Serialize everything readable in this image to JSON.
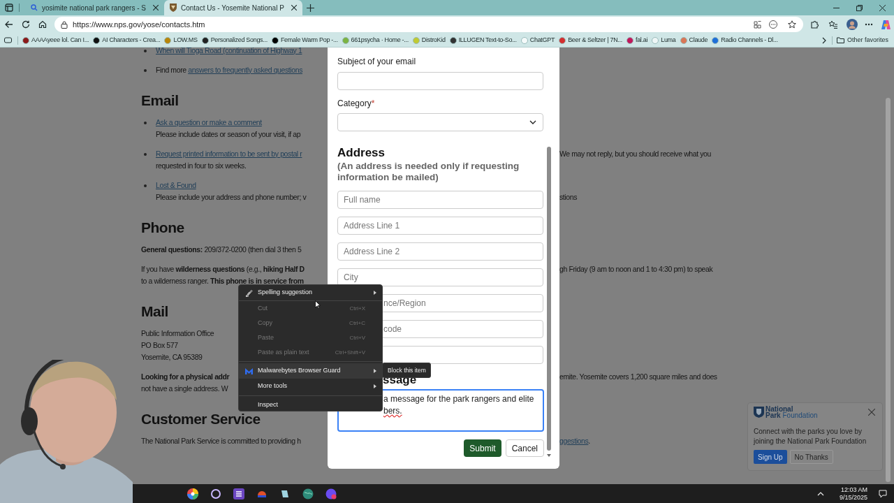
{
  "tabs": [
    {
      "title": "yosimite national park rangers - S",
      "kind": "search",
      "selected": false
    },
    {
      "title": "Contact Us - Yosemite National P",
      "kind": "site",
      "selected": true
    }
  ],
  "address_bar": {
    "url": "https://www.nps.gov/yose/contacts.htm"
  },
  "bookmarks": [
    {
      "label": "AAAAyeee lol. Can I...",
      "color": "#8b1a1a"
    },
    {
      "label": "AI Characters - Crea...",
      "color": "#111111"
    },
    {
      "label": "LOW.MS",
      "color": "#b8860b"
    },
    {
      "label": "Personalized Songs...",
      "color": "#222222"
    },
    {
      "label": "Female Warm Pop -...",
      "color": "#000000"
    },
    {
      "label": "661psycha · Home -...",
      "color": "#7cb342"
    },
    {
      "label": "DistroKid",
      "color": "#c0ca33"
    },
    {
      "label": "ILLUGEN Text-to-So...",
      "color": "#333333"
    },
    {
      "label": "ChatGPT",
      "color": "#f4fafa"
    },
    {
      "label": "Beer & Seltzer | 7N...",
      "color": "#d32f2f"
    },
    {
      "label": "fal.ai",
      "color": "#c2185b"
    },
    {
      "label": "Luma",
      "color": "#eef6f6"
    },
    {
      "label": "Claude",
      "color": "#d97757"
    },
    {
      "label": "Radio Channels - Dl...",
      "color": "#1e6fd9"
    }
  ],
  "other_favorites": "Other favorites",
  "page": {
    "blocks": [
      {
        "kind": "paragraph",
        "bullet": true,
        "lines": [
          {
            "left": [
              {
                "text": "When will Tioga Road (continuation of Highway 1",
                "link": true
              }
            ]
          }
        ]
      },
      {
        "kind": "paragraph",
        "bullet": true,
        "lines": [
          {
            "left": [
              {
                "text": "Find more ",
                "link": false
              },
              {
                "text": "answers to frequently asked questions",
                "link": true
              }
            ]
          }
        ]
      },
      {
        "kind": "heading",
        "text": "Email"
      },
      {
        "kind": "paragraph",
        "bullet": true,
        "lines": [
          {
            "left": [
              {
                "text": "Ask a question or make a comment",
                "link": true
              }
            ]
          },
          {
            "left": [
              {
                "text": "Please include dates or season of your visit, if ap",
                "link": false
              }
            ]
          }
        ]
      },
      {
        "kind": "paragraph",
        "bullet": true,
        "lines": [
          {
            "left": [
              {
                "text": "Request printed information to be sent by postal r",
                "link": true
              }
            ],
            "right": [
              {
                "text": "We may not reply, but you should receive what you",
                "link": false
              }
            ]
          },
          {
            "left": [
              {
                "text": "requested in four to six weeks.",
                "link": false
              }
            ]
          }
        ]
      },
      {
        "kind": "paragraph",
        "bullet": true,
        "lines": [
          {
            "left": [
              {
                "text": "Lost & Found",
                "link": true
              }
            ]
          },
          {
            "left": [
              {
                "text": "Please include your address and phone number; v",
                "link": false
              }
            ],
            "right": [
              {
                "text": "stions",
                "link": false
              }
            ]
          }
        ]
      },
      {
        "kind": "heading",
        "text": "Phone"
      },
      {
        "kind": "paragraph",
        "bullet": false,
        "lines": [
          {
            "left": [
              {
                "text": "**General questions:** 209/372-0200 (then dial 3 then 5",
                "link": false
              }
            ]
          }
        ]
      },
      {
        "kind": "paragraph",
        "bullet": false,
        "lines": [
          {
            "left": [
              {
                "text": "If you have **wilderness questions** (e.g., **hiking Half D**",
                "link": false
              }
            ],
            "right": [
              {
                "text": "gh Friday (9 am to noon and 1 to 4:30 pm) to speak",
                "link": false
              }
            ]
          },
          {
            "left": [
              {
                "text": "to a wilderness ranger. **This phone is in service from**",
                "link": false
              }
            ]
          }
        ]
      },
      {
        "kind": "heading",
        "text": "Mail"
      },
      {
        "kind": "paragraph",
        "bullet": false,
        "lines": [
          {
            "left": [
              {
                "text": "Public Information Office",
                "link": false
              }
            ]
          },
          {
            "left": [
              {
                "text": "PO Box 577",
                "link": false
              }
            ]
          },
          {
            "left": [
              {
                "text": "Yosemite, CA 95389",
                "link": false
              }
            ]
          }
        ]
      },
      {
        "kind": "paragraph",
        "bullet": false,
        "lines": [
          {
            "left": [
              {
                "text": "**Looking for a physical addr**",
                "link": false
              }
            ],
            "right": [
              {
                "text": "emite. Yosemite covers 1,200 square miles and does",
                "link": false
              }
            ]
          },
          {
            "left": [
              {
                "text": "not have a single address. W",
                "link": false
              }
            ]
          }
        ]
      },
      {
        "kind": "heading",
        "text": "Customer Service"
      },
      {
        "kind": "paragraph",
        "bullet": false,
        "lines": [
          {
            "left": [
              {
                "text": "The National Park Service is committed to providing h",
                "link": false
              }
            ],
            "right": [
              {
                "text": "ggestions",
                "link": true
              },
              {
                "text": ".",
                "link": false
              }
            ]
          }
        ]
      }
    ]
  },
  "form": {
    "subject_label": "Subject of your email",
    "category_label": "Category",
    "required_mark": "*",
    "address_heading": "Address",
    "address_note": "(An address is needed only if requesting information be mailed)",
    "address_fields": [
      {
        "kind": "text",
        "placeholder": "Full name",
        "covered": false
      },
      {
        "kind": "text",
        "placeholder": "Address Line 1",
        "covered": false
      },
      {
        "kind": "text",
        "placeholder": "Address Line 2",
        "covered": false
      },
      {
        "kind": "text",
        "placeholder": "City",
        "covered": false
      },
      {
        "kind": "text",
        "placeholder": "nce/Region",
        "covered": true
      },
      {
        "kind": "text",
        "placeholder": "code",
        "covered": true
      },
      {
        "kind": "text"
      }
    ],
    "message_heading": "ssage",
    "message_lines": [
      {
        "text": "a message for the park rangers and elite",
        "misspelled": false
      },
      {
        "text": "bers.",
        "misspelled": true
      }
    ],
    "submit": "Submit",
    "cancel": "Cancel"
  },
  "context_menu": {
    "items": [
      {
        "kind": "item",
        "label": "Spelling suggestion",
        "submenu": true,
        "disabled": false,
        "selected": false
      },
      {
        "kind": "divider"
      },
      {
        "kind": "item",
        "label": "Cut",
        "shortcut": "Ctrl+X",
        "submenu": false,
        "disabled": true,
        "selected": false
      },
      {
        "kind": "item",
        "label": "Copy",
        "shortcut": "Ctrl+C",
        "submenu": false,
        "disabled": true,
        "selected": false
      },
      {
        "kind": "item",
        "label": "Paste",
        "shortcut": "Ctrl+V",
        "submenu": false,
        "disabled": true,
        "selected": false
      },
      {
        "kind": "item",
        "label": "Paste as plain text",
        "shortcut": "Ctrl+Shift+V",
        "submenu": false,
        "disabled": true,
        "selected": false
      },
      {
        "kind": "divider"
      },
      {
        "kind": "item",
        "label": "Malwarebytes Browser Guard",
        "submenu": true,
        "disabled": false,
        "selected": true
      },
      {
        "kind": "item",
        "label": "More tools",
        "submenu": true,
        "disabled": false,
        "selected": false
      },
      {
        "kind": "divider"
      },
      {
        "kind": "item",
        "label": "Inspect",
        "submenu": false,
        "disabled": false,
        "selected": false
      }
    ],
    "submenu": {
      "label": "Block this item"
    }
  },
  "popup": {
    "logo_lines": [
      "National",
      "**Park** Foundation"
    ],
    "text": "Connect with the parks you love by joining the National Park Foundation",
    "primary": "Sign Up",
    "secondary": "No Thanks"
  },
  "taskbar": {
    "time": "12:03 AM",
    "date": "9/15/2025"
  }
}
